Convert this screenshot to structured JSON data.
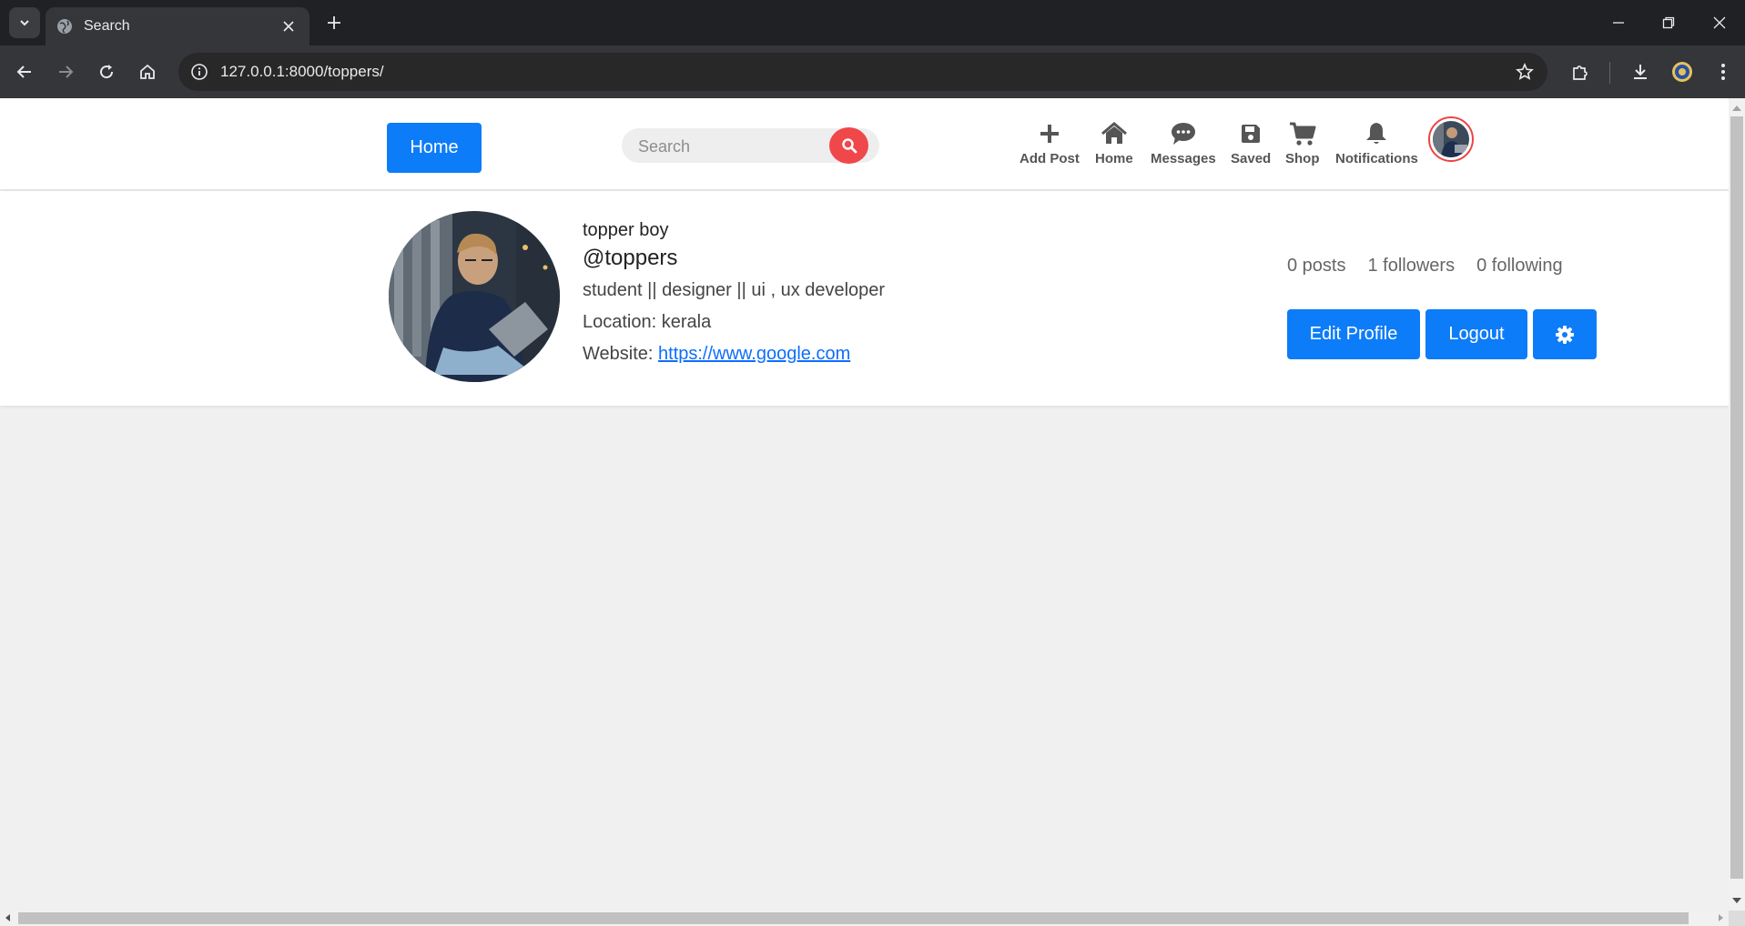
{
  "browser": {
    "tab_title": "Search",
    "url": "127.0.0.1:8000/toppers/"
  },
  "nav": {
    "home_label": "Home",
    "search_placeholder": "Search",
    "items": [
      {
        "label": "Add Post",
        "icon": "plus-icon"
      },
      {
        "label": "Home",
        "icon": "house-icon"
      },
      {
        "label": "Messages",
        "icon": "chat-bubble-icon"
      },
      {
        "label": "Saved",
        "icon": "floppy-disk-icon"
      },
      {
        "label": "Shop",
        "icon": "shopping-cart-icon"
      },
      {
        "label": "Notifications",
        "icon": "bell-icon"
      }
    ],
    "accent_color": "#0d7cf8",
    "search_button_color": "#f0474b"
  },
  "profile": {
    "display_name": "topper boy",
    "username": "@toppers",
    "bio": "student || designer || ui , ux developer",
    "location_prefix": "Location:",
    "location": "kerala",
    "website_prefix": "Website:",
    "website": "https://www.google.com",
    "stats": {
      "posts": "0 posts",
      "followers": "1 followers",
      "following": "0 following"
    },
    "buttons": {
      "edit": "Edit Profile",
      "logout": "Logout",
      "settings_icon": "gear-icon"
    }
  }
}
